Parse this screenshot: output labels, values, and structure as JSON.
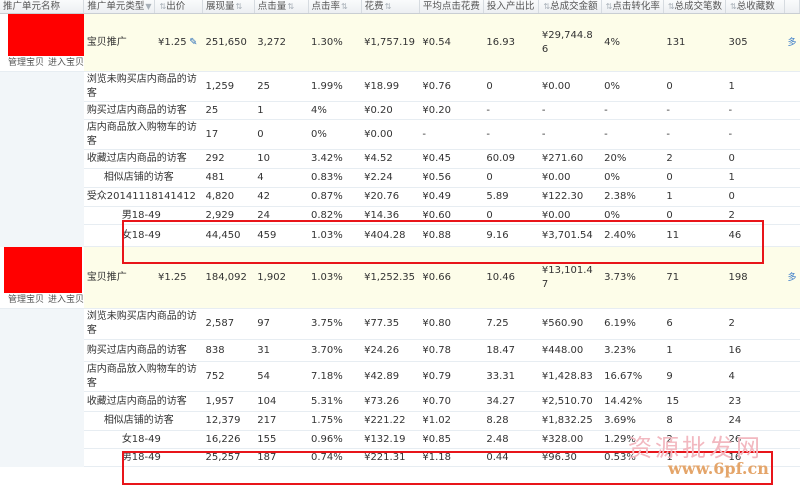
{
  "columns": [
    "推广单元名称",
    "推广单元类型",
    "出价",
    "展现量",
    "点击量",
    "点击率",
    "花费",
    "平均点击花费",
    "投入产出比",
    "总成交金额",
    "点击转化率",
    "总成交笔数",
    "总收藏数"
  ],
  "header_sub_left": "推广单元类型",
  "manage_label": "管理宝贝",
  "enter_label": "进入宝贝",
  "edit_icon": "pencil-icon",
  "groups": [
    {
      "parent": {
        "type": "宝贝推广",
        "bid": "¥1.25",
        "impressions": "251,650",
        "clicks": "3,272",
        "ctr": "1.30%",
        "cost": "¥1,757.19",
        "cpc": "¥0.54",
        "roi": "16.93",
        "gmv": "¥29,744.86",
        "cvr": "4%",
        "orders": "131",
        "favs": "305",
        "edge": "多"
      },
      "rows": [
        {
          "name": "浏览未购买店内商品的访客",
          "impressions": "1,259",
          "clicks": "25",
          "ctr": "1.99%",
          "cost": "¥18.99",
          "cpc": "¥0.76",
          "roi": "0",
          "gmv": "¥0.00",
          "cvr": "0%",
          "orders": "0",
          "favs": "1"
        },
        {
          "name": "购买过店内商品的访客",
          "impressions": "25",
          "clicks": "1",
          "ctr": "4%",
          "cost": "¥0.20",
          "cpc": "¥0.20",
          "roi": "-",
          "gmv": "-",
          "cvr": "-",
          "orders": "-",
          "favs": "-"
        },
        {
          "name": "店内商品放入购物车的访客",
          "impressions": "17",
          "clicks": "0",
          "ctr": "0%",
          "cost": "¥0.00",
          "cpc": "-",
          "roi": "-",
          "gmv": "-",
          "cvr": "-",
          "orders": "-",
          "favs": "-"
        },
        {
          "name": "收藏过店内商品的访客",
          "impressions": "292",
          "clicks": "10",
          "ctr": "3.42%",
          "cost": "¥4.52",
          "cpc": "¥0.45",
          "roi": "60.09",
          "gmv": "¥271.60",
          "cvr": "20%",
          "orders": "2",
          "favs": "0"
        },
        {
          "name": "相似店铺的访客",
          "impressions": "481",
          "clicks": "4",
          "ctr": "0.83%",
          "cost": "¥2.24",
          "cpc": "¥0.56",
          "roi": "0",
          "gmv": "¥0.00",
          "cvr": "0%",
          "orders": "0",
          "favs": "1"
        },
        {
          "name": "受众20141118141412",
          "impressions": "4,820",
          "clicks": "42",
          "ctr": "0.87%",
          "cost": "¥20.76",
          "cpc": "¥0.49",
          "roi": "5.89",
          "gmv": "¥122.30",
          "cvr": "2.38%",
          "orders": "1",
          "favs": "0"
        },
        {
          "name": "男18-49",
          "impressions": "2,929",
          "clicks": "24",
          "ctr": "0.82%",
          "cost": "¥14.36",
          "cpc": "¥0.60",
          "roi": "0",
          "gmv": "¥0.00",
          "cvr": "0%",
          "orders": "0",
          "favs": "2"
        },
        {
          "name": "女18-49",
          "impressions": "44,450",
          "clicks": "459",
          "ctr": "1.03%",
          "cost": "¥404.28",
          "cpc": "¥0.88",
          "roi": "9.16",
          "gmv": "¥3,701.54",
          "cvr": "2.40%",
          "orders": "11",
          "favs": "46"
        }
      ]
    },
    {
      "parent": {
        "type": "宝贝推广",
        "bid": "¥1.25",
        "impressions": "184,092",
        "clicks": "1,902",
        "ctr": "1.03%",
        "cost": "¥1,252.35",
        "cpc": "¥0.66",
        "roi": "10.46",
        "gmv": "¥13,101.47",
        "cvr": "3.73%",
        "orders": "71",
        "favs": "198",
        "edge": "多"
      },
      "rows": [
        {
          "name": "浏览未购买店内商品的访客",
          "impressions": "2,587",
          "clicks": "97",
          "ctr": "3.75%",
          "cost": "¥77.35",
          "cpc": "¥0.80",
          "roi": "7.25",
          "gmv": "¥560.90",
          "cvr": "6.19%",
          "orders": "6",
          "favs": "2"
        },
        {
          "name": "购买过店内商品的访客",
          "impressions": "838",
          "clicks": "31",
          "ctr": "3.70%",
          "cost": "¥24.26",
          "cpc": "¥0.78",
          "roi": "18.47",
          "gmv": "¥448.00",
          "cvr": "3.23%",
          "orders": "1",
          "favs": "16"
        },
        {
          "name": "店内商品放入购物车的访客",
          "impressions": "752",
          "clicks": "54",
          "ctr": "7.18%",
          "cost": "¥42.89",
          "cpc": "¥0.79",
          "roi": "33.31",
          "gmv": "¥1,428.83",
          "cvr": "16.67%",
          "orders": "9",
          "favs": "4"
        },
        {
          "name": "收藏过店内商品的访客",
          "impressions": "1,957",
          "clicks": "104",
          "ctr": "5.31%",
          "cost": "¥73.26",
          "cpc": "¥0.70",
          "roi": "34.27",
          "gmv": "¥2,510.70",
          "cvr": "14.42%",
          "orders": "15",
          "favs": "23"
        },
        {
          "name": "相似店铺的访客",
          "impressions": "12,379",
          "clicks": "217",
          "ctr": "1.75%",
          "cost": "¥221.22",
          "cpc": "¥1.02",
          "roi": "8.28",
          "gmv": "¥1,832.25",
          "cvr": "3.69%",
          "orders": "8",
          "favs": "24"
        },
        {
          "name": "女18-49",
          "impressions": "16,226",
          "clicks": "155",
          "ctr": "0.96%",
          "cost": "¥132.19",
          "cpc": "¥0.85",
          "roi": "2.48",
          "gmv": "¥328.00",
          "cvr": "1.29%",
          "orders": "2",
          "favs": "26"
        },
        {
          "name": "男18-49",
          "impressions": "25,257",
          "clicks": "187",
          "ctr": "0.74%",
          "cost": "¥221.31",
          "cpc": "¥1.18",
          "roi": "0.44",
          "gmv": "¥96.30",
          "cvr": "0.53%",
          "orders": "1",
          "favs": "16"
        }
      ]
    }
  ],
  "watermark": {
    "line1": "资源批发网",
    "line2": "www.6pf.cn"
  },
  "colors": {
    "highlight": "#e8151a",
    "placeholder_image": "#ff0000",
    "parent_row_bg": "#fdfde9",
    "link": "#2d6fb7"
  }
}
